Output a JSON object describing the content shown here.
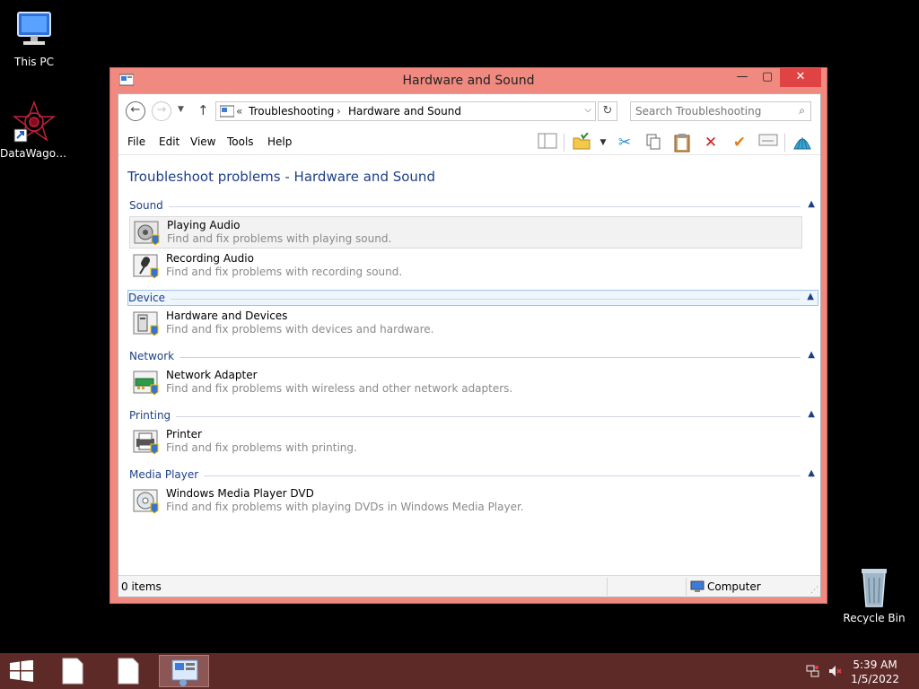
{
  "desktop": {
    "icons": [
      {
        "label": "This PC",
        "icon": "computer-icon"
      },
      {
        "label": "DataWagon...",
        "icon": "datawagon-shortcut-icon"
      },
      {
        "label": "Recycle Bin",
        "icon": "recycle-bin-icon"
      }
    ]
  },
  "window": {
    "title": "Hardware and Sound",
    "controls": {
      "minimize": "—",
      "maximize": "▢",
      "close": "✕"
    }
  },
  "address": {
    "overflow": "«",
    "crumbs": [
      "Troubleshooting",
      "Hardware and Sound"
    ],
    "separator": "›"
  },
  "search": {
    "placeholder": "Search Troubleshooting"
  },
  "menu": {
    "items": [
      "File",
      "Edit",
      "View",
      "Tools",
      "Help"
    ]
  },
  "toolbar": {
    "icons": [
      "layout-pane-icon",
      "folder-options-icon",
      "cut-icon",
      "copy-icon",
      "paste-icon",
      "delete-icon",
      "check-icon",
      "properties-icon",
      "shell-icon"
    ]
  },
  "page": {
    "title": "Troubleshoot problems - Hardware and Sound"
  },
  "groups": [
    {
      "name": "Sound",
      "items": [
        {
          "title": "Playing Audio",
          "desc": "Find and fix problems with playing sound."
        },
        {
          "title": "Recording Audio",
          "desc": "Find and fix problems with recording sound."
        }
      ]
    },
    {
      "name": "Device",
      "items": [
        {
          "title": "Hardware and Devices",
          "desc": "Find and fix problems with devices and hardware."
        }
      ]
    },
    {
      "name": "Network",
      "items": [
        {
          "title": "Network Adapter",
          "desc": "Find and fix problems with wireless and other network adapters."
        }
      ]
    },
    {
      "name": "Printing",
      "items": [
        {
          "title": "Printer",
          "desc": "Find and fix problems with printing."
        }
      ]
    },
    {
      "name": "Media Player",
      "items": [
        {
          "title": "Windows Media Player DVD",
          "desc": "Find and fix problems with playing DVDs in Windows Media Player."
        }
      ]
    }
  ],
  "status": {
    "count": "0 items",
    "zone": "Computer"
  },
  "taskbar": {
    "clock_time": "5:39 AM",
    "clock_date": "1/5/2022"
  },
  "colors": {
    "window_frame": "#f08a80",
    "close_button": "#e04343",
    "taskbar": "#5e2a28",
    "link_blue": "#1e3f86"
  }
}
